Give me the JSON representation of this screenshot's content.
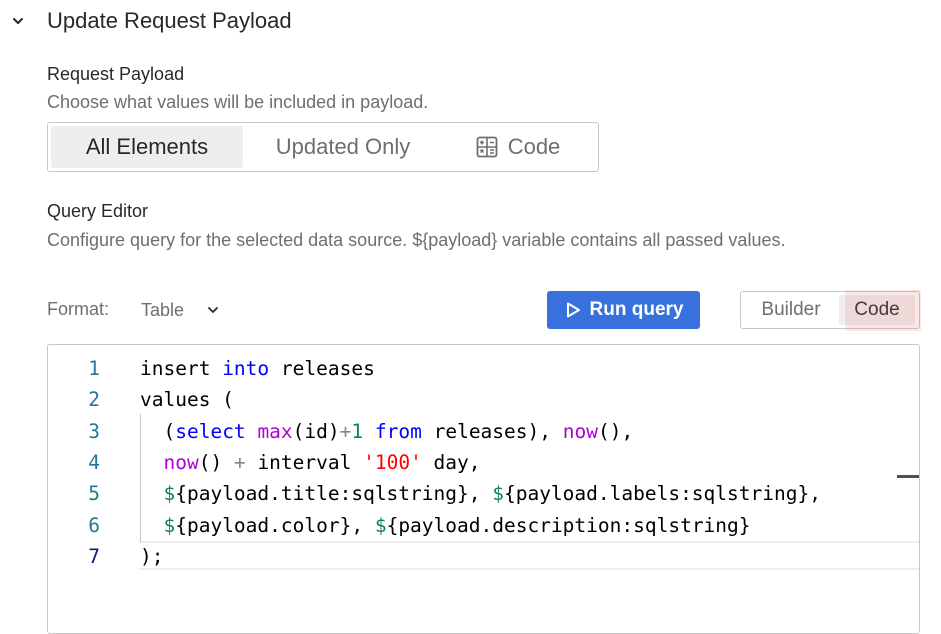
{
  "section": {
    "title": "Update Request Payload",
    "expanded": true,
    "toggle_icon": "chevron-down-icon"
  },
  "request_payload": {
    "label": "Request Payload",
    "description": "Choose what values will be included in payload.",
    "options": [
      {
        "label": "All Elements",
        "selected": true
      },
      {
        "label": "Updated Only",
        "selected": false
      },
      {
        "label": "Code",
        "selected": false,
        "icon": "calculator-icon"
      }
    ]
  },
  "query_editor": {
    "label": "Query Editor",
    "description": "Configure query for the selected data source. ${payload} variable contains all passed values.",
    "format_label": "Format:",
    "format_value": "Table",
    "run_button": "Run query",
    "run_icon": "play-icon",
    "modes": [
      {
        "label": "Builder",
        "selected": false
      },
      {
        "label": "Code",
        "selected": true,
        "highlighted": true
      }
    ],
    "accent_color": "#3871dc",
    "highlight_color": "#f07878",
    "current_line": 7,
    "code": {
      "line_numbers": [
        "1",
        "2",
        "3",
        "4",
        "5",
        "6",
        "7"
      ],
      "lines": [
        [
          {
            "t": "insert "
          },
          {
            "t": "into",
            "c": "kw"
          },
          {
            "t": " releases"
          }
        ],
        [
          {
            "t": "values ("
          }
        ],
        [
          {
            "t": "  ("
          },
          {
            "t": "select",
            "c": "kw"
          },
          {
            "t": " "
          },
          {
            "t": "max",
            "c": "fn"
          },
          {
            "t": "(id)"
          },
          {
            "t": "+",
            "c": "op"
          },
          {
            "t": "1",
            "c": "num"
          },
          {
            "t": " "
          },
          {
            "t": "from",
            "c": "kw"
          },
          {
            "t": " releases), "
          },
          {
            "t": "now",
            "c": "fn"
          },
          {
            "t": "(),"
          }
        ],
        [
          {
            "t": "  "
          },
          {
            "t": "now",
            "c": "fn"
          },
          {
            "t": "() "
          },
          {
            "t": "+",
            "c": "op"
          },
          {
            "t": " interval "
          },
          {
            "t": "'100'",
            "c": "str"
          },
          {
            "t": " day,"
          }
        ],
        [
          {
            "t": "  "
          },
          {
            "t": "$",
            "c": "var"
          },
          {
            "t": "{payload.title:sqlstring}, "
          },
          {
            "t": "$",
            "c": "var"
          },
          {
            "t": "{payload.labels:sqlstring},"
          }
        ],
        [
          {
            "t": "  "
          },
          {
            "t": "$",
            "c": "var"
          },
          {
            "t": "{payload.color}, "
          },
          {
            "t": "$",
            "c": "var"
          },
          {
            "t": "{payload.description:sqlstring}"
          }
        ],
        [
          {
            "t": ");"
          }
        ]
      ]
    }
  }
}
